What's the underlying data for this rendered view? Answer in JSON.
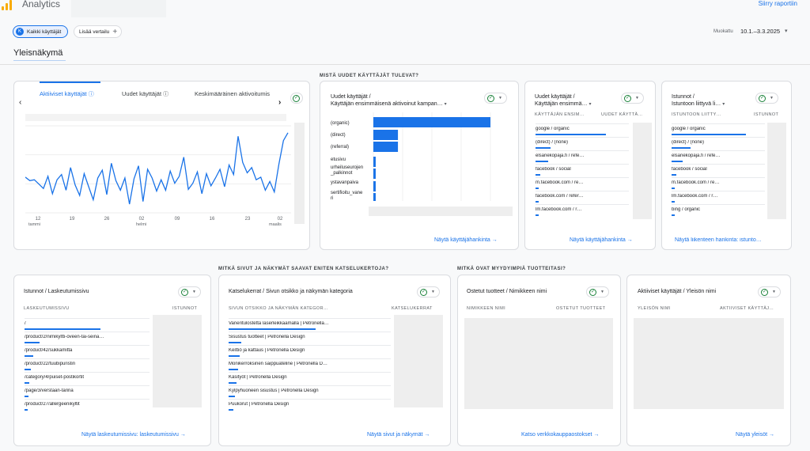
{
  "app": {
    "title": "Analytics",
    "top_link": "Siirry raportiin"
  },
  "chips": {
    "all_users": "Kaikki käyttäjät",
    "all_users_initial": "K",
    "add_compare": "Lisää vertailu"
  },
  "date": {
    "label": "Muokattu",
    "range": "10.1.–3.3.2025"
  },
  "page_title": "Yleisnäkymä",
  "sections": {
    "new_users": "MISTÄ UUDET KÄYTTÄJÄT TULEVAT?",
    "pages": "MITKÄ SIVUT JA NÄKYMÄT SAAVAT ENITEN KATSELUKERTOJA?",
    "products": "MITKÄ OVAT MYYDYIMPIÄ TUOTTEITASI?"
  },
  "overview_card": {
    "tabs": [
      "Aktiiviset käyttäjät",
      "Uudet käyttäjät",
      "Keskimääräinen aktivoitumis"
    ],
    "x_ticks": [
      "12",
      "19",
      "26",
      "02",
      "09",
      "16",
      "23",
      "02"
    ],
    "x_months": [
      "tammi",
      "helmi",
      "maalis"
    ]
  },
  "chart_data": {
    "type": "line",
    "title": "",
    "xlabel": "",
    "ylabel": "",
    "series": [
      {
        "values": [
          41,
          37,
          38,
          33,
          28,
          42,
          22,
          38,
          44,
          26,
          52,
          32,
          20,
          45,
          30,
          15,
          40,
          49,
          21,
          57,
          37,
          26,
          40,
          10,
          39,
          54,
          13,
          50,
          40,
          25,
          38,
          26,
          48,
          34,
          42,
          64,
          27,
          34,
          47,
          22,
          45,
          31,
          40,
          50,
          30,
          55,
          44,
          88,
          58,
          46,
          52,
          38,
          41,
          26,
          36,
          24,
          56,
          83,
          92
        ]
      }
    ]
  },
  "acq_bar_card": {
    "title_line1": "Uudet käyttäjät /",
    "title_line2": "Käyttäjän ensimmäisenä aktivoinut kampan…",
    "categories": [
      "(organic)",
      "(direct)",
      "(referral)",
      "etusivu",
      "urheiluseurojen_palkinnot",
      "ystavanpaiva",
      "sertifioitu_vaneri"
    ],
    "category_display": [
      "(organic)",
      "(direct)",
      "(referral)",
      "etusivu",
      "urheiluseurojen\n_palkinnot",
      "ystavanpaiva",
      "sertifioitu_vane\nri"
    ],
    "values": [
      100,
      21,
      21,
      2,
      2,
      2,
      2
    ],
    "link": "Näytä käyttäjähankinta"
  },
  "acq_table_card": {
    "title_line1": "Uudet käyttäjät /",
    "title_line2": "Käyttäjän ensimmä…",
    "col1": "KÄYTTÄJÄN ENSIM…",
    "col2": "UUDET KÄYTTÄ…",
    "rows": [
      {
        "label": "google / organic",
        "share": 0.74
      },
      {
        "label": "(direct) / (none)",
        "share": 0.16
      },
      {
        "label": "elsanekopaja.fi / refe…",
        "share": 0.13
      },
      {
        "label": "facebook / social",
        "share": 0.05
      },
      {
        "label": "m.facebook.com / re…",
        "share": 0.03
      },
      {
        "label": "facebook.com / refer…",
        "share": 0.03
      },
      {
        "label": "lm.facebook.com / r…",
        "share": 0.02
      }
    ],
    "link": "Näytä käyttäjähankinta"
  },
  "traffic_card": {
    "title_line1": "Istunnot /",
    "title_line2": "Istuntoon liittyvä li…",
    "col1": "ISTUNTOON LIITTY…",
    "col2": "ISTUNNOT",
    "rows": [
      {
        "label": "google / organic",
        "share": 0.78
      },
      {
        "label": "(direct) / (none)",
        "share": 0.2
      },
      {
        "label": "elsanekopaja.fi / refe…",
        "share": 0.12
      },
      {
        "label": "facebook / social",
        "share": 0.05
      },
      {
        "label": "m.facebook.com / re…",
        "share": 0.03
      },
      {
        "label": "lm.facebook.com / r…",
        "share": 0.02
      },
      {
        "label": "bing / organic",
        "share": 0.02
      }
    ],
    "link": "Näytä liikenteen hankinta: istunto…"
  },
  "landing_card": {
    "title": "Istunnot / Laskeutumissivu",
    "col1": "LASKEUTUMISSIVU",
    "col2": "ISTUNNOT",
    "rows": [
      {
        "label": "/",
        "share": 0.6
      },
      {
        "label": "/product/2/nimikyltti-oveen-tai-seina…",
        "share": 0.12
      },
      {
        "label": "/product/42/sukkamitta",
        "share": 0.07
      },
      {
        "label": "/product/22/tuubipuristin",
        "share": 0.05
      },
      {
        "label": "/category/4/puiset-postikortit",
        "share": 0.04
      },
      {
        "label": "/page/3/verstaan-tarina",
        "share": 0.03
      },
      {
        "label": "/product/27/allergeenikyltit",
        "share": 0.02
      }
    ],
    "link": "Näytä laskeutumissivu: laskeutumissivu"
  },
  "pages_card": {
    "title": "Katselukerrat / Sivun otsikko ja näkymän kategoria",
    "col1": "SIVUN OTSIKKO JA NÄKYMÄN KATEGOR…",
    "col2": "KATSELUKERRAT",
    "rows": [
      {
        "label": "Vaneritulostetta laserleikkaamalla | Petronella…",
        "share": 0.55
      },
      {
        "label": "Sisustus tuotteet | Petronella Design",
        "share": 0.08
      },
      {
        "label": "Keittiö ja kattaus | Petronella Design",
        "share": 0.07
      },
      {
        "label": "Monikerroksinen saippuateline | Petronella D…",
        "share": 0.06
      },
      {
        "label": "Käsityöt | Petronella Design",
        "share": 0.05
      },
      {
        "label": "Kylpyhuoneen sisustus | Petronella Design",
        "share": 0.04
      },
      {
        "label": "Puukorut | Petronella Design",
        "share": 0.03
      }
    ],
    "link": "Näytä sivut ja näkymät"
  },
  "products_card": {
    "title": "Ostetut tuotteet / Nimikkeen nimi",
    "col1": "NIMIKKEEN NIMI",
    "col2": "OSTETUT TUOTTEET",
    "link": "Katso verkkokauppaostokset"
  },
  "country_card": {
    "title": "Aktiiviset käyttäjät / Yleisön nimi",
    "col1": "YLEISÖN NIMI",
    "col2": "AKTIIVISET KÄYTTÄJ…",
    "link": "Näytä yleisöt"
  },
  "colors": {
    "accent": "#1a73e8",
    "check": "#188038",
    "logo": "#f9ab00"
  },
  "icons": {
    "check": "check-circle-icon",
    "dropdown": "chevron-down-icon",
    "arrow": "arrow-right-icon",
    "help": "help-icon"
  }
}
